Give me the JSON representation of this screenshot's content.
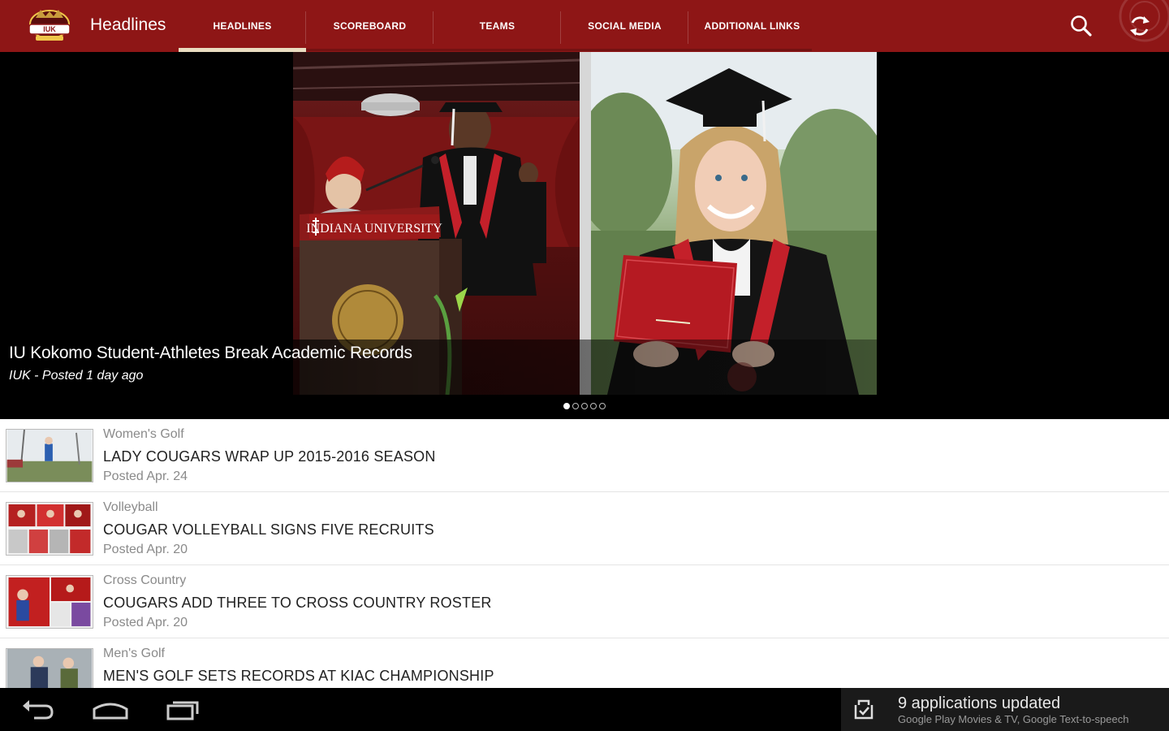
{
  "app": {
    "title": "Headlines",
    "logo_icon": "cougars-logo",
    "accent_color": "#8e1616"
  },
  "tabs": [
    {
      "label": "HEADLINES",
      "active": true
    },
    {
      "label": "SCOREBOARD",
      "active": false
    },
    {
      "label": "TEAMS",
      "active": false
    },
    {
      "label": "SOCIAL MEDIA",
      "active": false
    },
    {
      "label": "ADDITIONAL LINKS",
      "active": false
    }
  ],
  "actions": [
    {
      "name": "search-icon"
    },
    {
      "name": "refresh-icon"
    }
  ],
  "hero": {
    "title": "IU Kokomo Student-Athletes Break Academic Records",
    "meta": "IUK - Posted 1 day ago",
    "podium_text": "INDIANA UNIVERSITY",
    "pager_count": 5,
    "pager_active": 0
  },
  "articles": [
    {
      "category": "Women's Golf",
      "headline": "LADY COUGARS WRAP UP 2015-2016 SEASON",
      "posted": "Posted Apr. 24"
    },
    {
      "category": "Volleyball",
      "headline": "COUGAR VOLLEYBALL SIGNS FIVE RECRUITS",
      "posted": "Posted Apr. 20"
    },
    {
      "category": "Cross Country",
      "headline": "COUGARS ADD THREE TO CROSS COUNTRY ROSTER",
      "posted": "Posted Apr. 20"
    },
    {
      "category": "Men's Golf",
      "headline": "MEN'S GOLF SETS RECORDS AT KIAC CHAMPIONSHIP",
      "posted": ""
    }
  ],
  "navbar": {
    "buttons": [
      "back-icon",
      "home-icon",
      "recent-apps-icon"
    ]
  },
  "notification": {
    "title": "9 applications updated",
    "subtitle": "Google Play Movies & TV, Google Text-to-speech",
    "icon": "play-store-update-icon"
  }
}
